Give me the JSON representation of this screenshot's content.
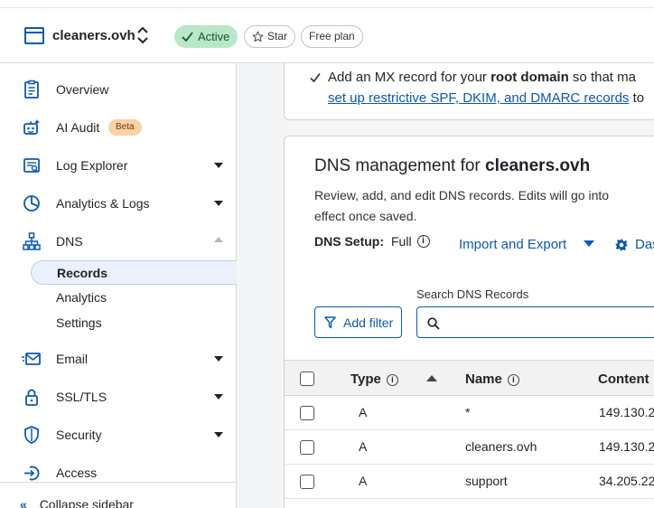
{
  "header": {
    "zone_name": "cleaners.ovh",
    "status_badge": "Active",
    "star_label": "Star",
    "plan_label": "Free plan"
  },
  "sidebar": {
    "items": [
      {
        "label": "Overview",
        "icon": "clipboard-icon"
      },
      {
        "label": "AI Audit",
        "icon": "robot-icon",
        "badge": "Beta"
      },
      {
        "label": "Log Explorer",
        "icon": "log-explorer-icon"
      },
      {
        "label": "Analytics & Logs",
        "icon": "pie-chart-icon"
      },
      {
        "label": "DNS",
        "icon": "sitemap-icon"
      },
      {
        "label": "Email",
        "icon": "email-icon"
      },
      {
        "label": "SSL/TLS",
        "icon": "lock-icon"
      },
      {
        "label": "Security",
        "icon": "shield-icon"
      },
      {
        "label": "Access",
        "icon": "access-icon"
      }
    ],
    "dns_subitems": [
      "Records",
      "Analytics",
      "Settings"
    ],
    "collapse_label": "Collapse sidebar"
  },
  "mx_notice": {
    "line1_prefix": "Add an MX record for your ",
    "line1_bold": "root domain",
    "line1_suffix": " so that ma",
    "line2_link": "set up restrictive SPF, DKIM, and DMARC records",
    "line2_suffix": " to"
  },
  "dns": {
    "title_prefix": "DNS management for ",
    "title_domain": "cleaners.ovh",
    "description": "Review, add, and edit DNS records. Edits will go into effect once saved.",
    "setup_label": "DNS Setup:",
    "setup_value": "Full",
    "import_export": "Import and Export",
    "dashboard_link": "Das",
    "search_label": "Search DNS Records",
    "search_value": "",
    "add_filter": "Add filter",
    "columns": [
      "Type",
      "Name",
      "Content"
    ],
    "rows": [
      {
        "type": "A",
        "name": "*",
        "content": "149.130.2"
      },
      {
        "type": "A",
        "name": "cleaners.ovh",
        "content": "149.130.2"
      },
      {
        "type": "A",
        "name": "support",
        "content": "34.205.22"
      }
    ]
  },
  "colors": {
    "accent": "#0a58b8",
    "active_badge_bg": "#b9e8c8",
    "beta_badge_bg": "#fbd2a4",
    "selected_nav_bg": "#eaf1fb"
  }
}
